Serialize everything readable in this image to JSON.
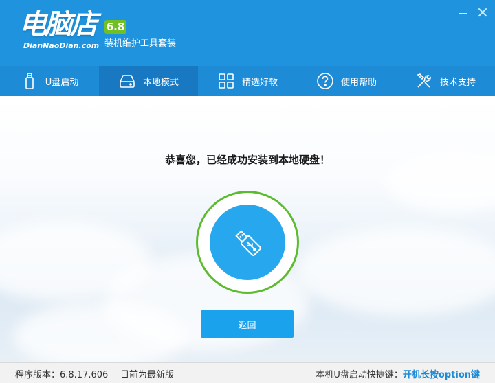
{
  "app": {
    "logo_text": "电脑店",
    "logo_url_text": "DianNaoDian.com",
    "version": "6.8",
    "subtitle": "装机维护工具套装"
  },
  "nav": {
    "tabs": [
      {
        "label": "U盘启动",
        "icon": "usb-drive-icon"
      },
      {
        "label": "本地模式",
        "icon": "hard-disk-icon"
      },
      {
        "label": "精选好软",
        "icon": "grid-apps-icon"
      },
      {
        "label": "使用帮助",
        "icon": "help-icon"
      },
      {
        "label": "技术支持",
        "icon": "tools-icon"
      }
    ],
    "active_index": 1
  },
  "main": {
    "message": "恭喜您，已经成功安装到本地硬盘！",
    "icon": "usb-icon",
    "back_button": "返回"
  },
  "status": {
    "version_label": "程序版本：6.8.17.606",
    "update_status": "目前为最新版",
    "hotkey_label": "本机U盘启动快捷键：",
    "hotkey_value": "开机长按option键"
  },
  "colors": {
    "header_bg": "#1f93dd",
    "nav_bg": "#1d8bd6",
    "nav_active_bg": "#1878c1",
    "badge_green": "#6fbf25",
    "ring_green": "#5cbc2e",
    "usb_blue": "#27a8ee",
    "button_blue": "#1aa3ec"
  }
}
